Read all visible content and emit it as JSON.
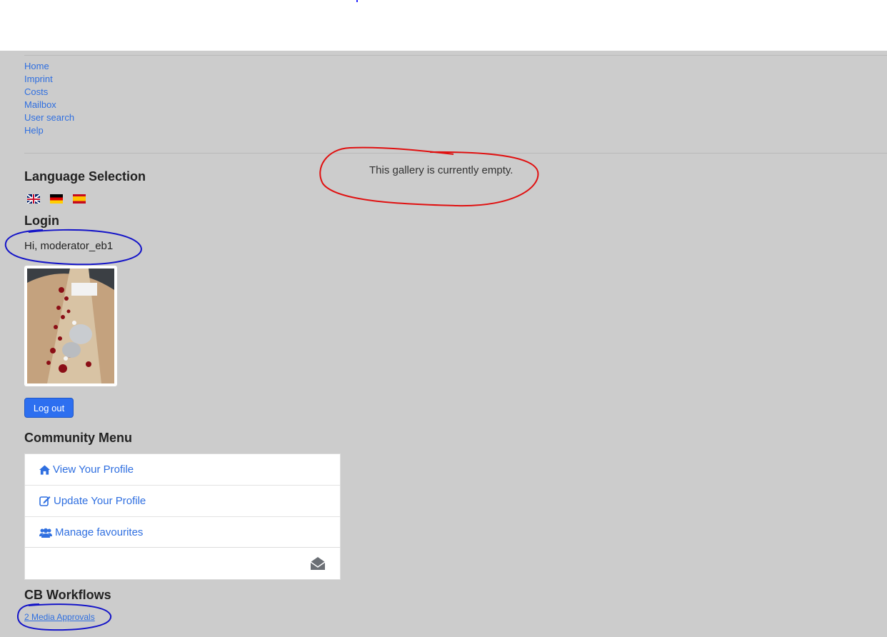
{
  "nav": {
    "items": [
      "Home",
      "Imprint",
      "Costs",
      "Mailbox",
      "User search",
      "Help"
    ]
  },
  "language": {
    "heading": "Language Selection",
    "flags": [
      "flag-gb-icon",
      "flag-de-icon",
      "flag-es-icon"
    ]
  },
  "login": {
    "heading": "Login",
    "greeting": "Hi, moderator_eb1",
    "logout_label": "Log out"
  },
  "community_menu": {
    "heading": "Community Menu",
    "items": [
      {
        "label": "View Your Profile",
        "icon": "home-icon"
      },
      {
        "label": "Update Your Profile",
        "icon": "edit-icon"
      },
      {
        "label": "Manage favourites",
        "icon": "users-icon"
      }
    ],
    "mailbox_icon": "envelope-open-icon"
  },
  "workflows": {
    "heading": "CB Workflows",
    "link": "2 Media Approvals"
  },
  "gallery": {
    "empty_message": "This gallery is currently empty."
  },
  "colors": {
    "link": "#2f6fe0",
    "background": "#cccccc",
    "button": "#2d6ff0",
    "annotation_red": "#e01010",
    "annotation_blue": "#1414c8"
  }
}
